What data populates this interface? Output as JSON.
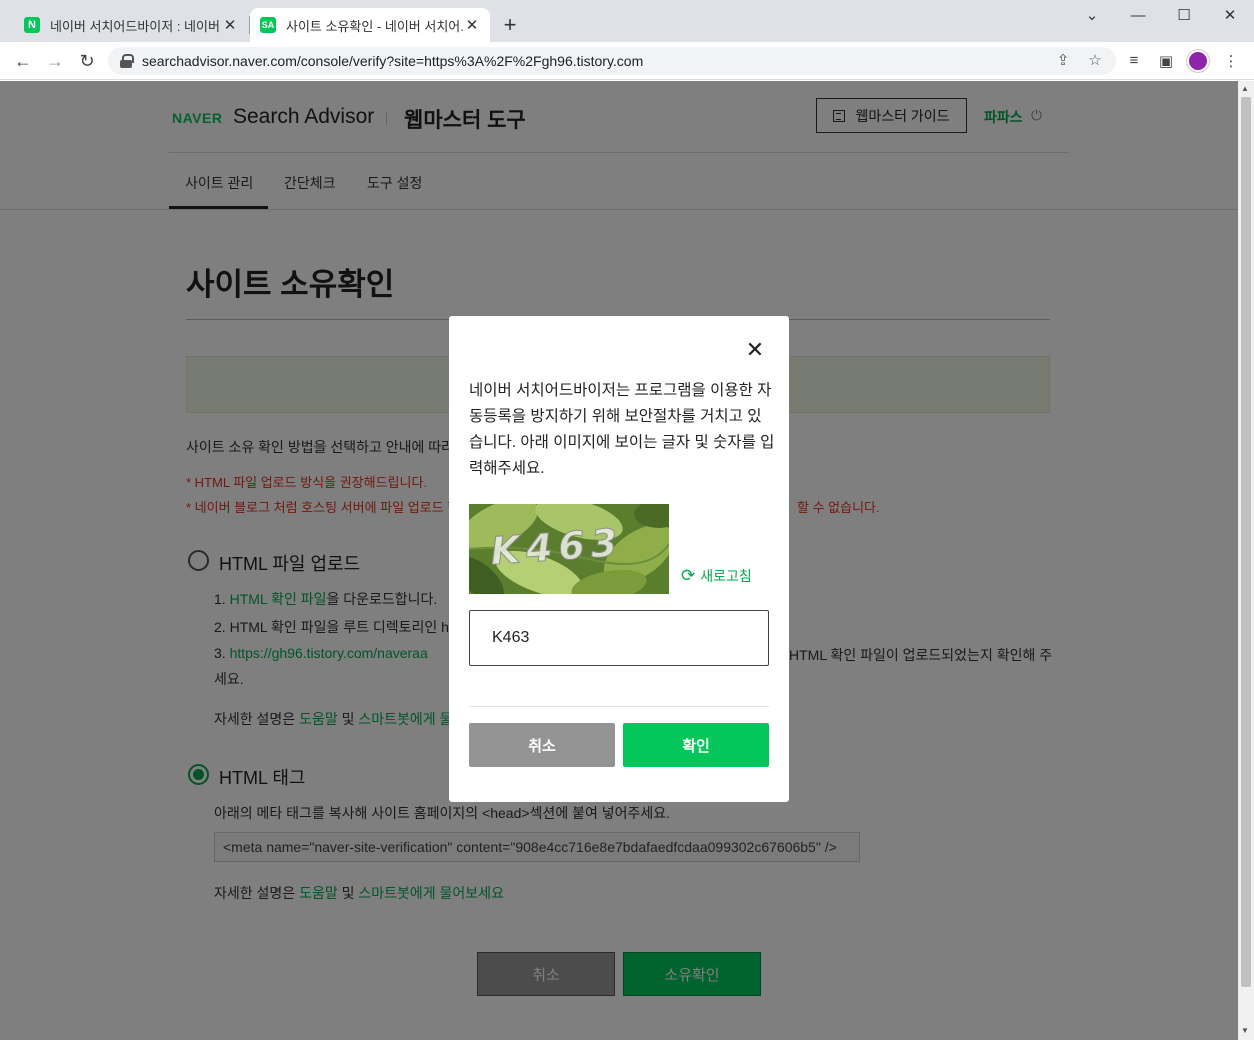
{
  "browser": {
    "tabs": [
      {
        "title": "네이버 서치어드바이저 : 네이버 ..."
      },
      {
        "title": "사이트 소유확인 - 네이버 서치어..."
      }
    ],
    "url": "searchadvisor.naver.com/console/verify?site=https%3A%2F%2Fgh96.tistory.com",
    "favicon_n": "N",
    "favicon_sa": "SA"
  },
  "header": {
    "naver_logo": "NAVER",
    "product": "Search Advisor",
    "tool": "웹마스터 도구",
    "guide_label": "웹마스터 가이드",
    "user": "파파스"
  },
  "nav": {
    "tabs": [
      "사이트 관리",
      "간단체크",
      "도구 설정"
    ]
  },
  "main": {
    "title": "사이트 소유확인",
    "desc": "사이트 소유 확인 방법을 선택하고 안내에 따라 주",
    "warn1": "* HTML 파일 업로드 방식을 권장해드립니다.",
    "warn2": "* 네이버 블로그 처럼 호스팅 서버에 파일 업로드 할",
    "warn2_tail": "할 수 없습니다.",
    "option_file": {
      "label": "HTML 파일 업로드",
      "step1_link": "HTML 확인 파일",
      "step1_rest": "을 다운로드합니다.",
      "step2": "2. HTML 확인 파일을 루트 디렉토리인 htt",
      "step3_link": "https://gh96.tistory.com/naveraa",
      "step3_tail": "HTML 확인 파일이 업로드되었는지 확인해 주",
      "step3_wrap": "세요.",
      "help_prefix": "자세한 설명은 ",
      "help_link1": "도움말",
      "help_mid": " 및 ",
      "help_link2": "스마트봇에게 물어"
    },
    "option_tag": {
      "label": "HTML 태그",
      "instruction": "아래의 메타 태그를 복사해 사이트 홈페이지의 <head>섹션에 붙여 넣어주세요.",
      "meta": "<meta name=\"naver-site-verification\" content=\"908e4cc716e8e7bdafaedfcdaa099302c67606b5\" />",
      "help_prefix": "자세한 설명은 ",
      "help_link1": "도움말",
      "help_mid": " 및 ",
      "help_link2": "스마트봇에게 물어보세요"
    },
    "cancel_label": "취소",
    "verify_label": "소유확인"
  },
  "modal": {
    "message": "네이버 서치어드바이저는 프로그램을 이용한 자동등록을 방지하기 위해 보안절차를 거치고 있습니다. 아래 이미지에 보이는 글자 및 숫자를 입력해주세요.",
    "captcha_text": "K463",
    "refresh_label": "새로고침",
    "input_value": "K463",
    "cancel_label": "취소",
    "ok_label": "확인"
  },
  "colors": {
    "brand_green": "#03c75a",
    "link_green": "#03a94e",
    "warn_red": "#e0321e"
  }
}
